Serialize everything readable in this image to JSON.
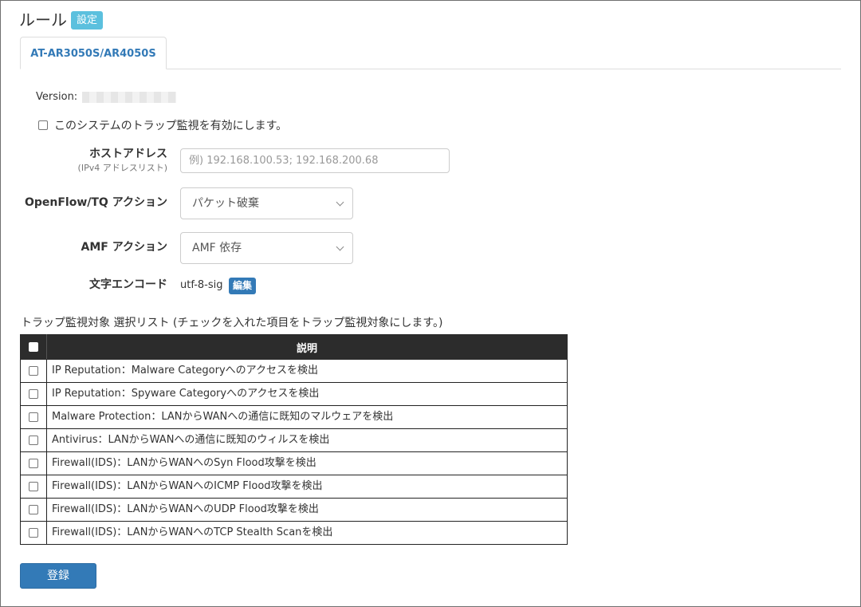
{
  "header": {
    "title": "ルール",
    "badge": "設定"
  },
  "tabs": [
    {
      "label": "AT-AR3050S/AR4050S",
      "active": true
    }
  ],
  "version": {
    "label": "Version:"
  },
  "enable_trap": {
    "label": "このシステムのトラップ監視を有効にします。",
    "checked": false
  },
  "host_address": {
    "label": "ホストアドレス",
    "sublabel": "(IPv4 アドレスリスト)",
    "placeholder": "例) 192.168.100.53; 192.168.200.68"
  },
  "openflow_action": {
    "label": "OpenFlow/TQ アクション",
    "selected": "パケット破棄"
  },
  "amf_action": {
    "label": "AMF アクション",
    "selected": "AMF 依存"
  },
  "encoding": {
    "label": "文字エンコード",
    "value": "utf-8-sig",
    "edit_label": "編集"
  },
  "trap_list": {
    "caption": "トラップ監視対象 選択リスト (チェックを入れた項目をトラップ監視対象にします。)",
    "column_description": "説明",
    "rows": [
      {
        "description": "IP Reputation：Malware Categoryへのアクセスを検出",
        "checked": false
      },
      {
        "description": "IP Reputation：Spyware Categoryへのアクセスを検出",
        "checked": false
      },
      {
        "description": "Malware Protection：LANからWANへの通信に既知のマルウェアを検出",
        "checked": false
      },
      {
        "description": "Antivirus：LANからWANへの通信に既知のウィルスを検出",
        "checked": false
      },
      {
        "description": "Firewall(IDS)：LANからWANへのSyn Flood攻撃を検出",
        "checked": false
      },
      {
        "description": "Firewall(IDS)：LANからWANへのICMP Flood攻撃を検出",
        "checked": false
      },
      {
        "description": "Firewall(IDS)：LANからWANへのUDP Flood攻撃を検出",
        "checked": false
      },
      {
        "description": "Firewall(IDS)：LANからWANへのTCP Stealth Scanを検出",
        "checked": false
      }
    ]
  },
  "submit": {
    "label": "登録"
  },
  "colors": {
    "accent": "#337ab7",
    "badge": "#5bc0de",
    "table_header": "#2c2c2c"
  }
}
